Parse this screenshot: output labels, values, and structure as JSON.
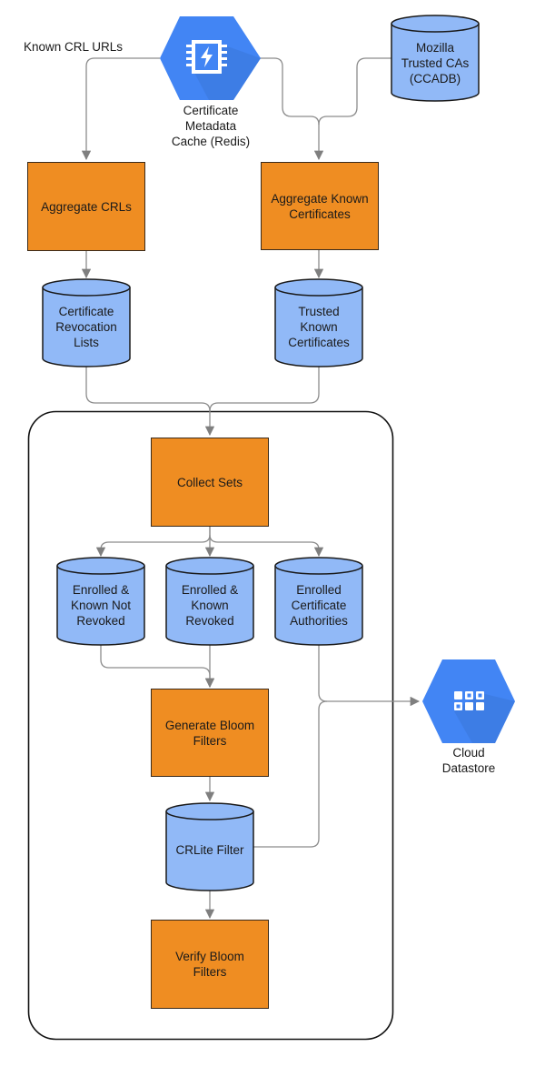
{
  "colors": {
    "process_fill": "#ef8d22",
    "process_stroke": "#3a2a1a",
    "datastore_fill": "#91b9f7",
    "datastore_stroke": "#1a1a1a",
    "hexagon_fill": "#4285f4",
    "hexagon_shadow": "#3a76d8",
    "connector": "#7f7f7f",
    "container_stroke": "#111111"
  },
  "edge_labels": {
    "known_crl_urls": "Known CRL URLs"
  },
  "services": {
    "redis": {
      "label": "Certificate\nMetadata\nCache (Redis)",
      "icon": "memorystore-icon"
    },
    "datastore": {
      "label": "Cloud\nDatastore",
      "icon": "datastore-icon"
    }
  },
  "datastores": {
    "ccadb": "Mozilla\nTrusted CAs\n(CCADB)",
    "crls": "Certificate\nRevocation\nLists",
    "trusted_known": "Trusted\nKnown\nCertificates",
    "not_revoked": "Enrolled &\nKnown Not\nRevoked",
    "revoked": "Enrolled &\nKnown\nRevoked",
    "enrolled_cas": "Enrolled\nCertificate\nAuthorities",
    "crlite_filter": "CRLite Filter"
  },
  "processes": {
    "aggregate_crls": "Aggregate CRLs",
    "aggregate_known": "Aggregate Known\nCertificates",
    "collect_sets": "Collect Sets",
    "generate_bloom": "Generate Bloom\nFilters",
    "verify_bloom": "Verify Bloom\nFilters"
  }
}
